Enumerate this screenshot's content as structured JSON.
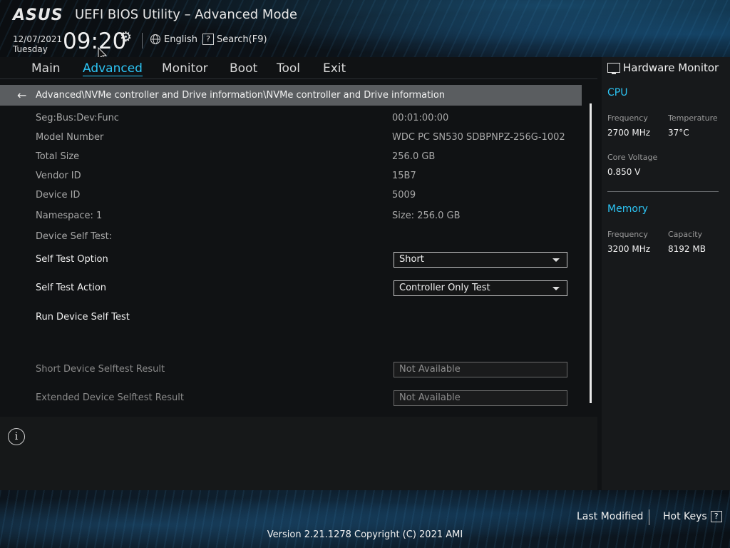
{
  "header": {
    "logo": "ASUS",
    "title": "UEFI BIOS Utility – Advanced Mode",
    "date": "12/07/2021",
    "day": "Tuesday",
    "time": "09:20",
    "language": "English",
    "search": "Search(F9)",
    "search_icon_glyph": "?"
  },
  "menu": {
    "items": [
      "Main",
      "Advanced",
      "Monitor",
      "Boot",
      "Tool",
      "Exit"
    ],
    "active": "Advanced"
  },
  "breadcrumb": "Advanced\\NVMe controller and Drive information\\NVMe controller and Drive information",
  "info": [
    {
      "label": "Seg:Bus:Dev:Func",
      "value": "00:01:00:00"
    },
    {
      "label": "Model Number",
      "value": "WDC PC SN530 SDBPNPZ-256G-1002"
    },
    {
      "label": "Total Size",
      "value": "256.0 GB"
    },
    {
      "label": "Vendor ID",
      "value": "15B7"
    },
    {
      "label": "Device ID",
      "value": "5009"
    },
    {
      "label": "Namespace: 1",
      "value": "Size: 256.0 GB"
    },
    {
      "label": "Device Self Test:",
      "value": ""
    }
  ],
  "self_test_option": {
    "label": "Self Test Option",
    "value": "Short"
  },
  "self_test_action": {
    "label": "Self Test Action",
    "value": "Controller Only Test"
  },
  "run_self_test": "Run Device Self Test",
  "short_result": {
    "label": "Short Device Selftest Result",
    "value": "Not Available"
  },
  "extended_result": {
    "label": "Extended Device Selftest Result",
    "value": "Not Available"
  },
  "info_icon_glyph": "i",
  "hardware_monitor": {
    "title": "Hardware Monitor",
    "cpu": {
      "heading": "CPU",
      "frequency_label": "Frequency",
      "frequency": "2700 MHz",
      "temperature_label": "Temperature",
      "temperature": "37°C",
      "voltage_label": "Core Voltage",
      "voltage": "0.850 V"
    },
    "memory": {
      "heading": "Memory",
      "frequency_label": "Frequency",
      "frequency": "3200 MHz",
      "capacity_label": "Capacity",
      "capacity": "8192 MB"
    }
  },
  "footer": {
    "last_modified": "Last Modified",
    "hot_keys": "Hot Keys",
    "hot_keys_glyph": "?",
    "version": "Version 2.21.1278 Copyright (C) 2021 AMI"
  },
  "colors": {
    "accent": "#2dc5f5",
    "breadcrumb_bg": "#5a5d60"
  }
}
